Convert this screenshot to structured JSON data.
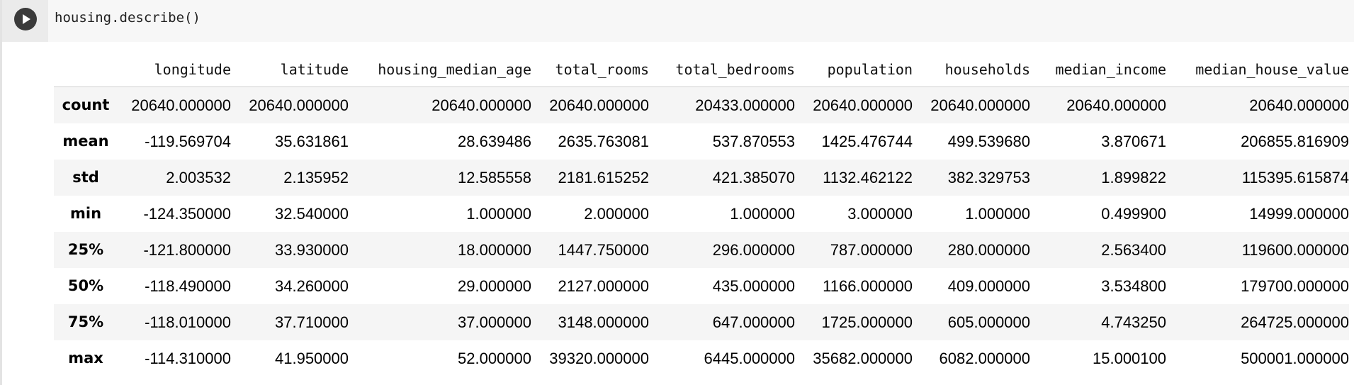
{
  "cell": {
    "code": "housing.describe()",
    "run_icon": "play-icon"
  },
  "table": {
    "columns": [
      "",
      "longitude",
      "latitude",
      "housing_median_age",
      "total_rooms",
      "total_bedrooms",
      "population",
      "households",
      "median_income",
      "median_house_value"
    ],
    "rows": [
      {
        "label": "count",
        "values": [
          "20640.000000",
          "20640.000000",
          "20640.000000",
          "20640.000000",
          "20433.000000",
          "20640.000000",
          "20640.000000",
          "20640.000000",
          "20640.000000"
        ]
      },
      {
        "label": "mean",
        "values": [
          "-119.569704",
          "35.631861",
          "28.639486",
          "2635.763081",
          "537.870553",
          "1425.476744",
          "499.539680",
          "3.870671",
          "206855.816909"
        ]
      },
      {
        "label": "std",
        "values": [
          "2.003532",
          "2.135952",
          "12.585558",
          "2181.615252",
          "421.385070",
          "1132.462122",
          "382.329753",
          "1.899822",
          "115395.615874"
        ]
      },
      {
        "label": "min",
        "values": [
          "-124.350000",
          "32.540000",
          "1.000000",
          "2.000000",
          "1.000000",
          "3.000000",
          "1.000000",
          "0.499900",
          "14999.000000"
        ]
      },
      {
        "label": "25%",
        "values": [
          "-121.800000",
          "33.930000",
          "18.000000",
          "1447.750000",
          "296.000000",
          "787.000000",
          "280.000000",
          "2.563400",
          "119600.000000"
        ]
      },
      {
        "label": "50%",
        "values": [
          "-118.490000",
          "34.260000",
          "29.000000",
          "2127.000000",
          "435.000000",
          "1166.000000",
          "409.000000",
          "3.534800",
          "179700.000000"
        ]
      },
      {
        "label": "75%",
        "values": [
          "-118.010000",
          "37.710000",
          "37.000000",
          "3148.000000",
          "647.000000",
          "1725.000000",
          "605.000000",
          "4.743250",
          "264725.000000"
        ]
      },
      {
        "label": "max",
        "values": [
          "-114.310000",
          "41.950000",
          "52.000000",
          "39320.000000",
          "6445.000000",
          "35682.000000",
          "6082.000000",
          "15.000100",
          "500001.000000"
        ]
      }
    ]
  }
}
